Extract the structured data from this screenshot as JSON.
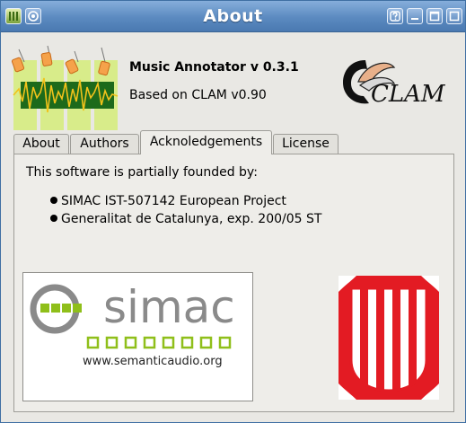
{
  "window": {
    "title": "About"
  },
  "header": {
    "app_name": "Music Annotator v 0.3.1",
    "based_on": "Based on CLAM v0.90",
    "clam_logo_text": "CLAM"
  },
  "tabs": [
    {
      "label": "About",
      "active": false
    },
    {
      "label": "Authors",
      "active": false
    },
    {
      "label": "Acknoledgements",
      "active": true
    },
    {
      "label": "License",
      "active": false
    }
  ],
  "acknowledgements": {
    "intro": "This software is partially founded by:",
    "items": [
      "SIMAC IST-507142 European Project",
      "Generalitat de Catalunya, exp. 200/05 ST"
    ],
    "simac_logo": {
      "word": "simac",
      "url": "www.semanticaudio.org"
    }
  },
  "colors": {
    "titlebar": "#5b8ac0",
    "simac_green": "#8fbf1a",
    "catalonia_red": "#e31b23"
  }
}
